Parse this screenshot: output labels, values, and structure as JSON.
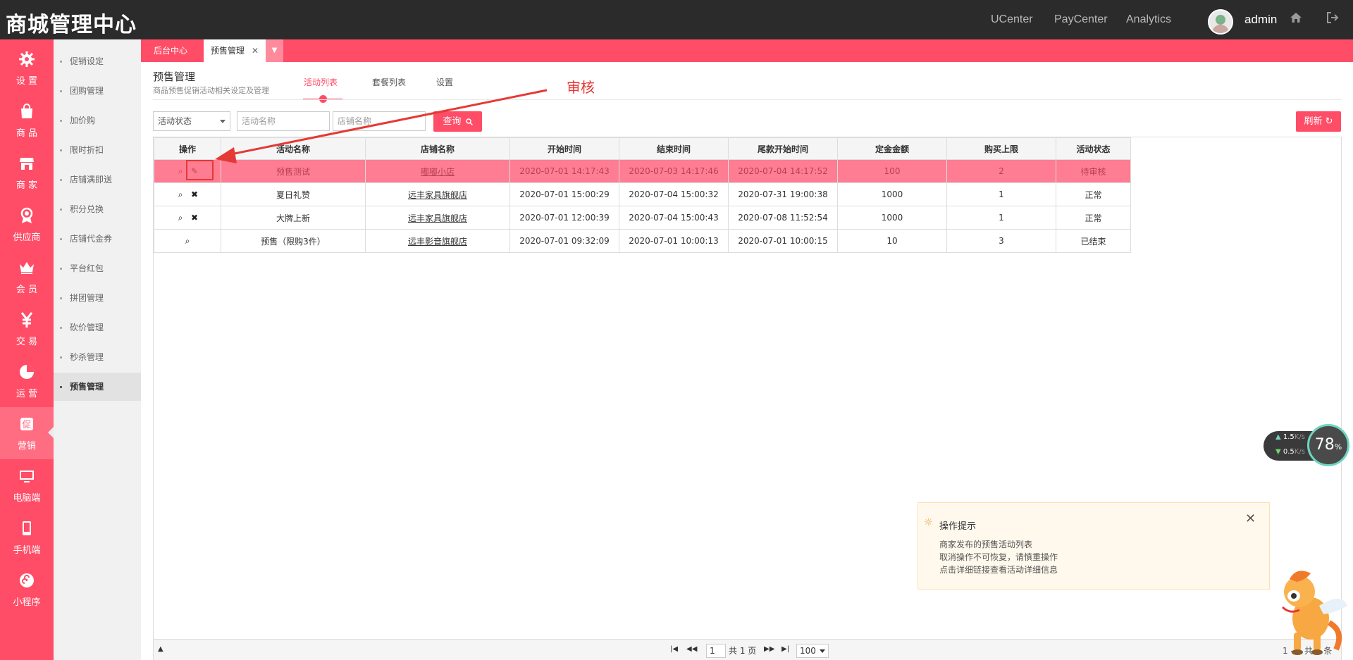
{
  "app": {
    "title": "商城管理中心"
  },
  "topnav": {
    "links": [
      "UCenter",
      "PayCenter",
      "Analytics"
    ],
    "user": "admin"
  },
  "sidebar": {
    "items": [
      "设 置",
      "商 品",
      "商 家",
      "供应商",
      "会 员",
      "交 易",
      "运 营",
      "营销",
      "电脑端",
      "手机端",
      "小程序"
    ]
  },
  "submenu": {
    "items": [
      "促销设定",
      "团购管理",
      "加价购",
      "限时折扣",
      "店铺满即送",
      "积分兑换",
      "店铺代金券",
      "平台红包",
      "拼团管理",
      "砍价管理",
      "秒杀管理",
      "预售管理"
    ]
  },
  "tabs": {
    "items": [
      "后台中心",
      "预售管理"
    ]
  },
  "page": {
    "title": "预售管理",
    "subtitle": "商品预售促销活动相关设定及管理"
  },
  "subtabs": {
    "items": [
      "活动列表",
      "套餐列表",
      "设置"
    ]
  },
  "filters": {
    "status_placeholder": "活动状态",
    "name_placeholder": "活动名称",
    "shop_placeholder": "店铺名称",
    "query_label": "查询",
    "refresh_label": "刷新"
  },
  "table": {
    "headers": [
      "操作",
      "活动名称",
      "店铺名称",
      "开始时间",
      "结束时间",
      "尾款开始时间",
      "定金金额",
      "购买上限",
      "活动状态"
    ],
    "rows": [
      [
        "",
        "预售测试",
        "嘟嘟小店",
        "2020-07-01 14:17:43",
        "2020-07-03 14:17:46",
        "2020-07-04 14:17:52",
        "100",
        "2",
        "待审核"
      ],
      [
        "",
        "夏日礼赞",
        "远丰家具旗舰店",
        "2020-07-01 15:00:29",
        "2020-07-04 15:00:32",
        "2020-07-31 19:00:38",
        "1000",
        "1",
        "正常"
      ],
      [
        "",
        "大牌上新",
        "远丰家具旗舰店",
        "2020-07-01 12:00:39",
        "2020-07-04 15:00:43",
        "2020-07-08 11:52:54",
        "1000",
        "1",
        "正常"
      ],
      [
        "",
        "预售（限购3件）",
        "远丰影音旗舰店",
        "2020-07-01 09:32:09",
        "2020-07-01 10:00:13",
        "2020-07-01 10:00:15",
        "10",
        "3",
        "已结束"
      ]
    ]
  },
  "pager": {
    "page": "1",
    "total_pages": "共 1 页",
    "page_size": "100",
    "summary": "1 - 4 共 4 条"
  },
  "annotation": {
    "label": "审核"
  },
  "tips": {
    "title": "操作提示",
    "lines": [
      "商家发布的预售活动列表",
      "取消操作不可恢复，请慎重操作",
      "点击详细链接查看活动详细信息"
    ]
  },
  "speed": {
    "up": "1.5",
    "down": "0.5",
    "unit": "K/s",
    "percent": "78",
    "percent_unit": "%"
  },
  "colors": {
    "accent": "#ff4d67",
    "topbar": "#2b2b2b",
    "selected_row": "#ff7d92"
  }
}
